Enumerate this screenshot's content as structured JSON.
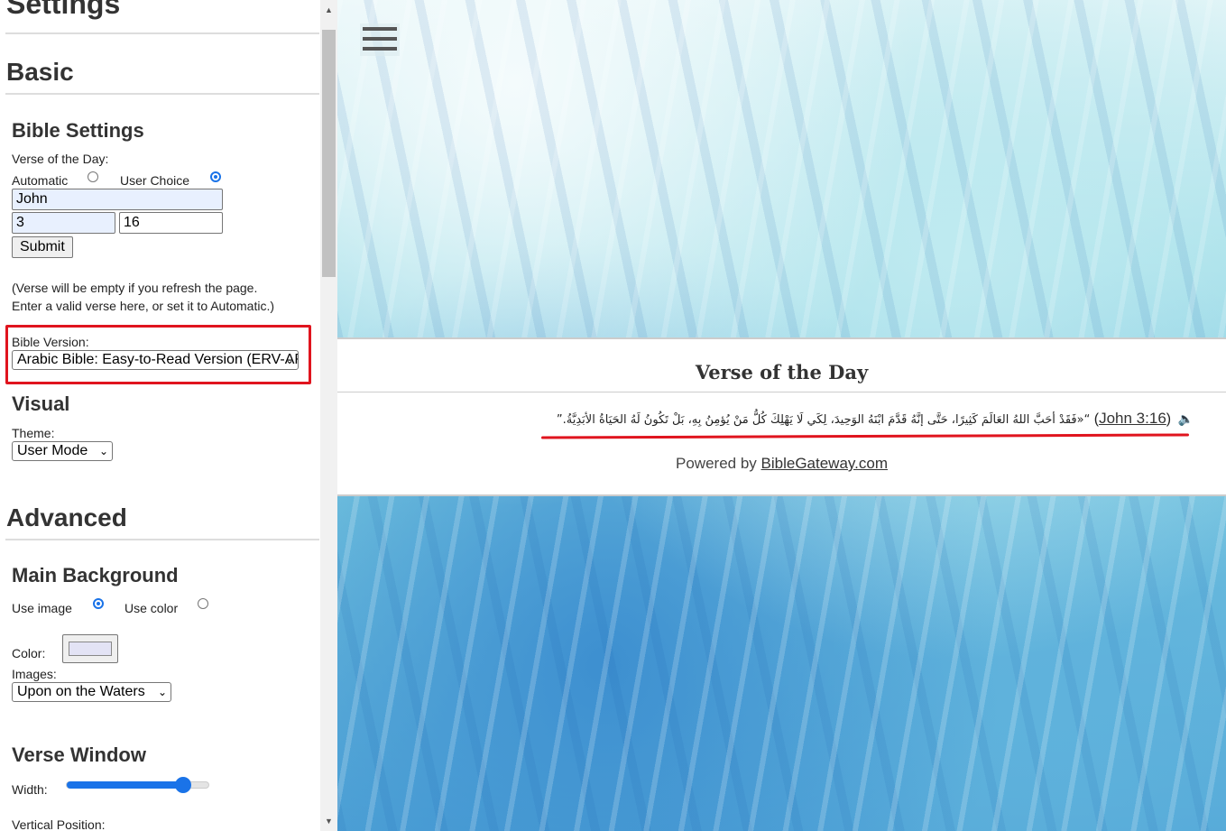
{
  "panel": {
    "title": "Settings",
    "basic_heading": "Basic",
    "bible_settings": {
      "heading": "Bible Settings",
      "verse_of_day_label": "Verse of the Day:",
      "automatic_label": "Automatic",
      "user_choice_label": "User Choice",
      "selected_mode": "User Choice",
      "book_value": "John",
      "chapter_value": "3",
      "verse_value": "16",
      "submit_label": "Submit",
      "note_line1": "(Verse will be empty if you refresh the page.",
      "note_line2": "Enter a valid verse here, or set it to Automatic.)",
      "version_label": "Bible Version:",
      "version_value": "Arabic Bible: Easy-to-Read Version (ERV-AR)"
    },
    "visual": {
      "heading": "Visual",
      "theme_label": "Theme:",
      "theme_value": "User Mode"
    },
    "advanced_heading": "Advanced",
    "main_background": {
      "heading": "Main Background",
      "use_image_label": "Use image",
      "use_color_label": "Use color",
      "selected": "Use image",
      "color_label": "Color:",
      "color_value": "#e3e3f5",
      "images_label": "Images:",
      "images_value": "Upon on the Waters"
    },
    "verse_window": {
      "heading": "Verse Window",
      "width_label": "Width:",
      "width_value": 0.82,
      "vertical_label": "Vertical Position:"
    }
  },
  "main": {
    "menu_icon": "hamburger-menu-icon",
    "verse_card": {
      "title": "Verse of the Day",
      "verse_text": "“«فَقَدْ أحَبَّ اللهُ العَالَمَ كَثِيرًا، حَتَّى إنَّهُ قَدَّمَ ابْنَهُ الوَحِيدَ، لِكَي لَا يَهْلِكَ كُلُّ مَنْ يُؤمِنُ بِهِ، بَلْ تَكُونُ لَهُ الحَيَاةُ الأبَدِيَّةُ.”",
      "reference": "John 3:16",
      "speaker_icon": "speaker-icon",
      "powered_prefix": "Powered by ",
      "powered_link": "BibleGateway.com"
    }
  },
  "colors": {
    "accent": "#1a73e8",
    "highlight_red": "#e0141e"
  }
}
